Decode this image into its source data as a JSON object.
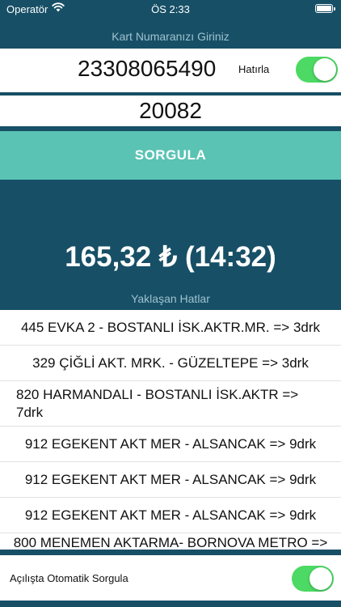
{
  "status_bar": {
    "carrier": "Operatör",
    "time": "ÖS 2:33"
  },
  "card_section": {
    "caption": "Kart Numaranızı Giriniz",
    "card_number": "23308065490",
    "remember_label": "Hatırla",
    "remember_on": true,
    "pin_value": "20082"
  },
  "query_button_label": "SORGULA",
  "balance_text": "165,32 ₺ (14:32)",
  "lines_caption": "Yaklaşan Hatlar",
  "lines": [
    "445 EVKA 2 - BOSTANLI İSK.AKTR.MR. => 3drk",
    "329 ÇİĞLİ AKT. MRK. - GÜZELTEPE => 3drk",
    "820 HARMANDALI - BOSTANLI İSK.AKTR => 7drk",
    "912 EGEKENT AKT MER - ALSANCAK => 9drk",
    "912 EGEKENT AKT MER - ALSANCAK => 9drk",
    "912 EGEKENT AKT MER - ALSANCAK => 9drk",
    "800 MENEMEN AKTARMA- BORNOVA METRO =>"
  ],
  "auto_query": {
    "label": "Açılışta Otomatik Sorgula",
    "enabled": true
  },
  "colors": {
    "background": "#174f66",
    "button": "#5ac3b4",
    "toggle_on": "#4cd964"
  }
}
